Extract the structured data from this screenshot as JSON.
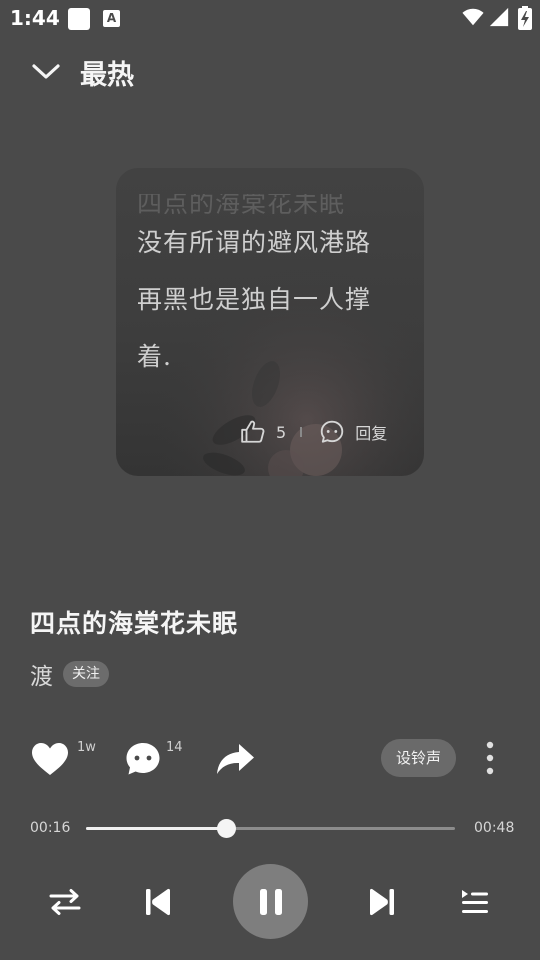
{
  "status_bar": {
    "time": "1:44",
    "a_badge": "A"
  },
  "header": {
    "title": "最热"
  },
  "comment": {
    "faded_line": "四点的海棠花未眠",
    "lines": [
      "没有所谓的避风港路",
      "再黑也是独自一人撑",
      "着."
    ],
    "like_count": "5",
    "reply_label": "回复"
  },
  "song": {
    "title": "四点的海棠花未眠",
    "artist": "渡",
    "follow_label": "关注"
  },
  "actions": {
    "like_total": "1w",
    "comment_total": "14",
    "ringtone_label": "设铃声"
  },
  "progress": {
    "current": "00:16",
    "total": "00:48",
    "fraction": 0.38
  },
  "colors": {
    "background": "#4a4a4a",
    "accent": "#f5f5f5",
    "muted": "#8c8c8c"
  },
  "icons": {
    "collapse": "chevron-down-icon",
    "like": "thumbs-up-icon",
    "reply": "comment-bubble-icon",
    "heart": "heart-icon",
    "comment": "comment-dots-icon",
    "share": "share-arrow-icon",
    "more": "more-vertical-icon",
    "repeat": "repeat-icon",
    "prev": "skip-previous-icon",
    "pause": "pause-icon",
    "next": "skip-next-icon",
    "playlist": "playlist-icon"
  }
}
